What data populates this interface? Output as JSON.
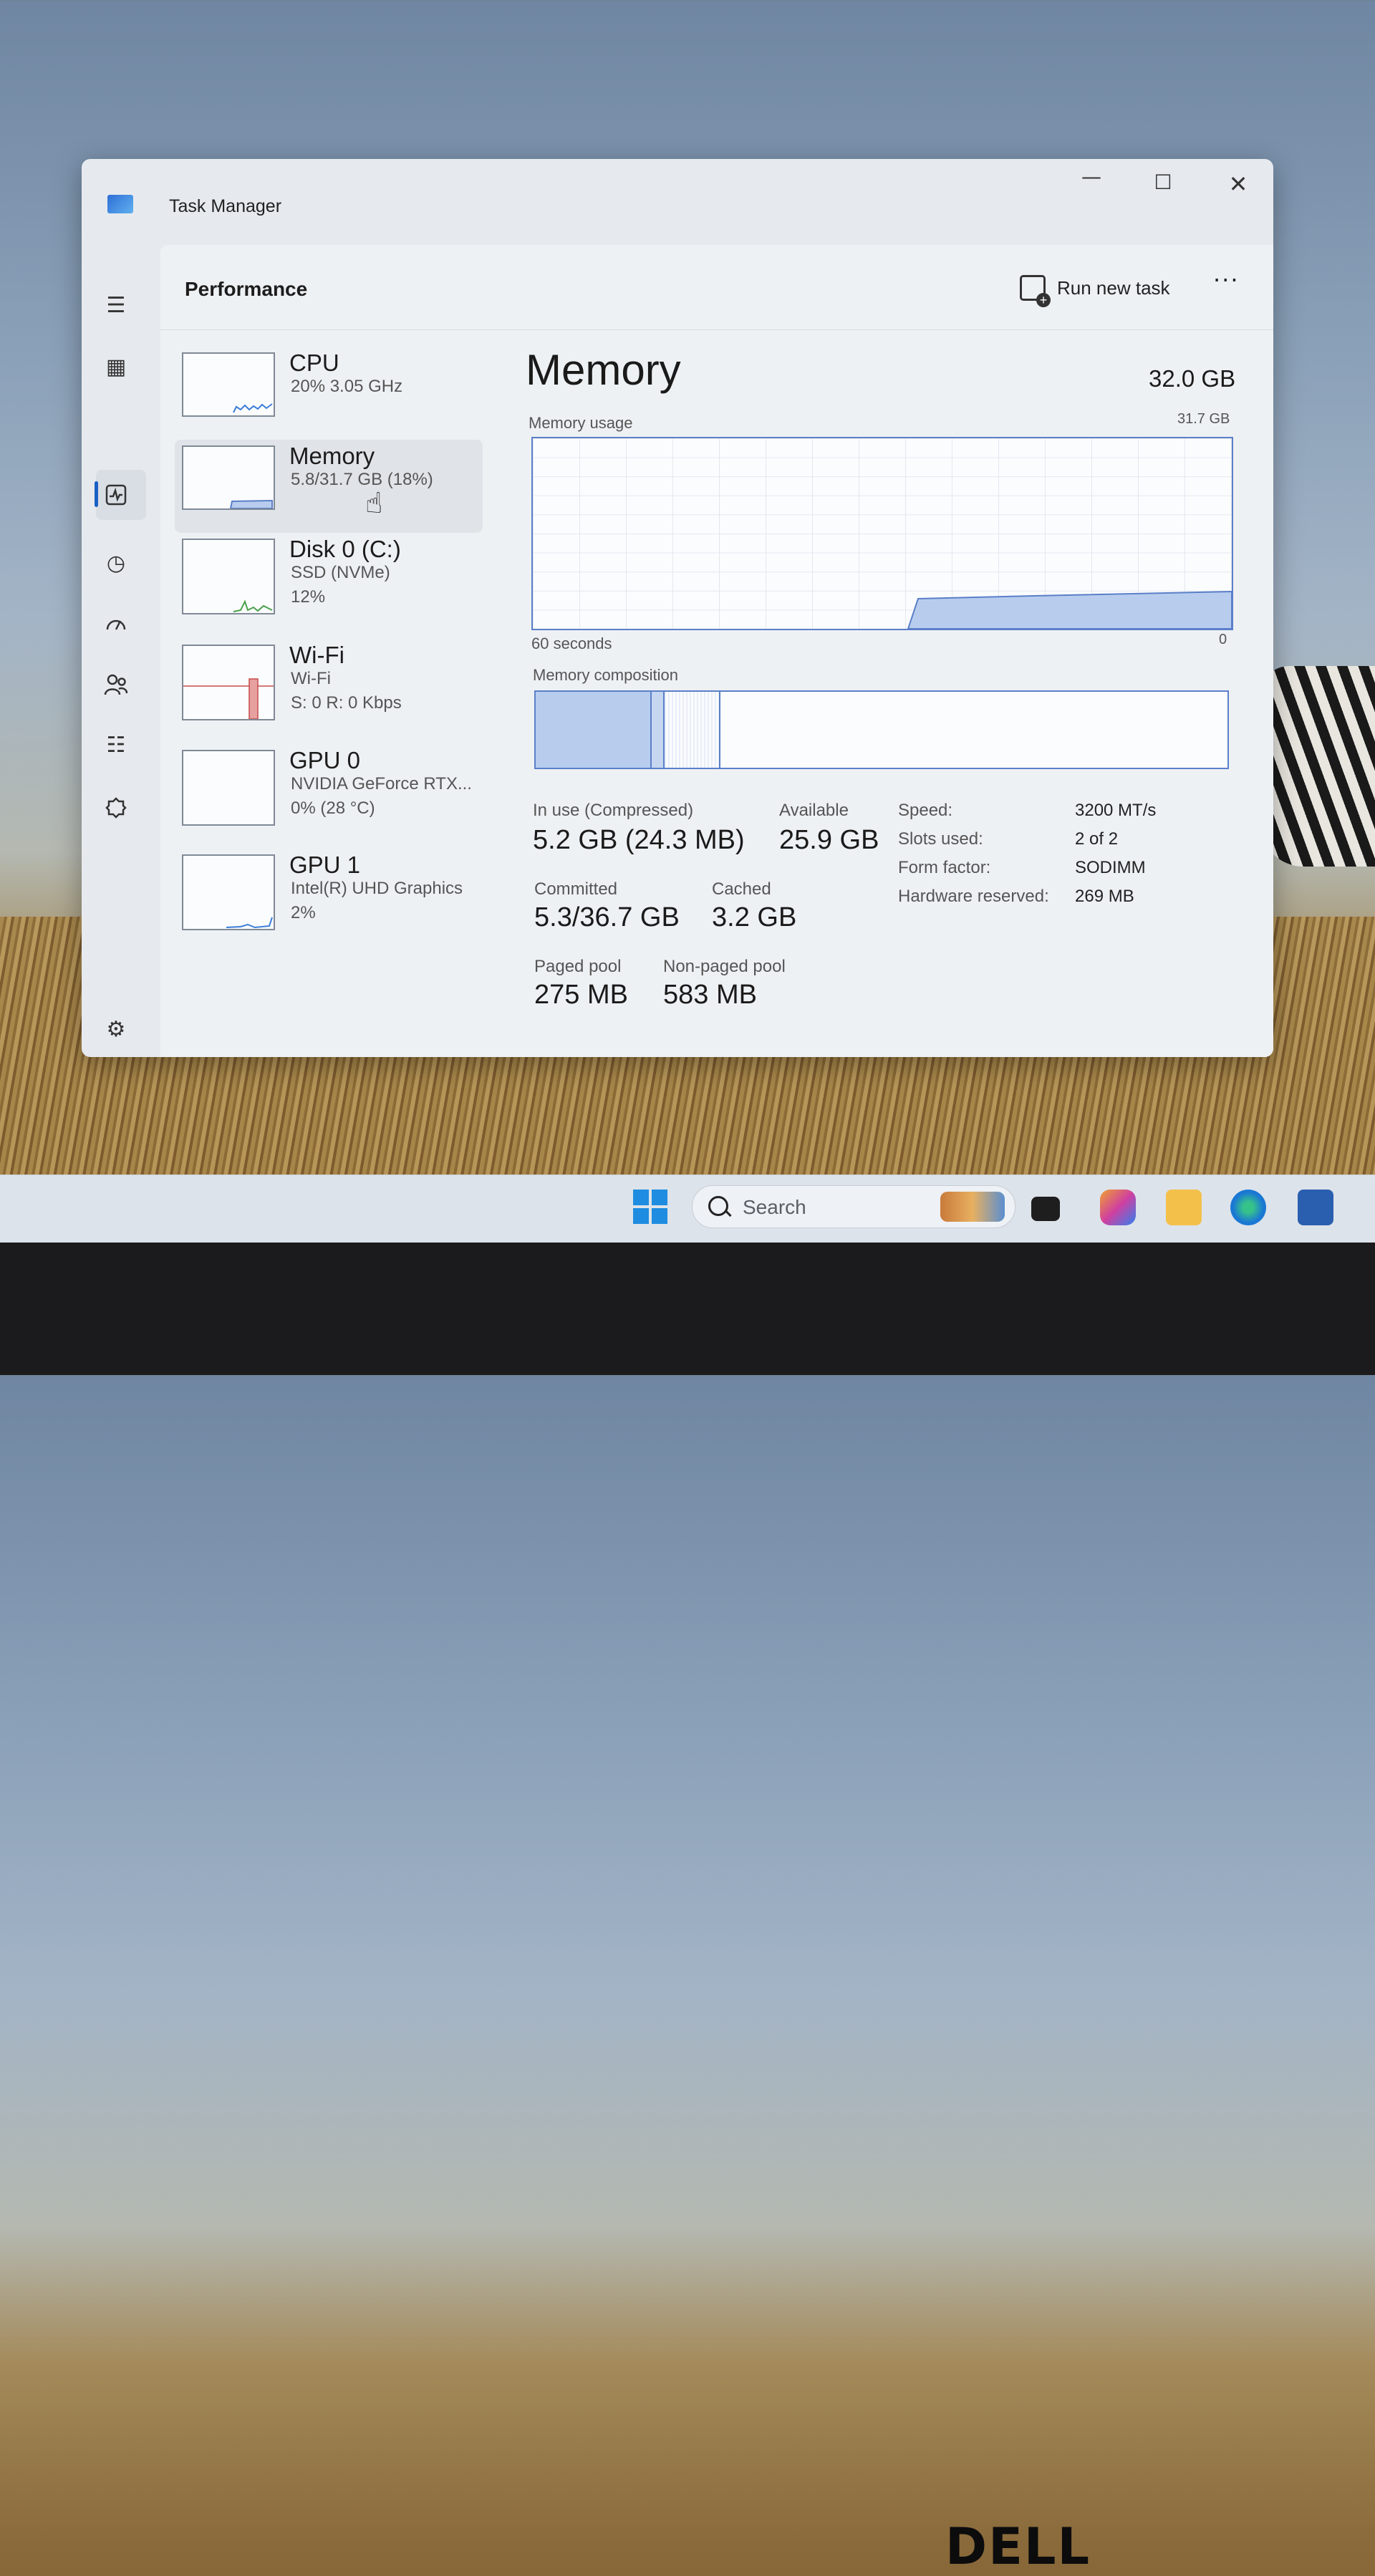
{
  "window": {
    "title": "Task Manager"
  },
  "header": {
    "page_title": "Performance",
    "run_new_task": "Run new task",
    "more": "···"
  },
  "nav_icons": [
    "hamburger-icon",
    "processes-icon",
    "performance-icon",
    "app-history-icon",
    "startup-apps-icon",
    "users-icon",
    "details-icon",
    "services-icon",
    "settings-icon"
  ],
  "devices": [
    {
      "name": "CPU",
      "sub1": "20% 3.05 GHz",
      "sub2": ""
    },
    {
      "name": "Memory",
      "sub1": "5.8/31.7 GB (18%)",
      "sub2": ""
    },
    {
      "name": "Disk 0 (C:)",
      "sub1": "SSD (NVMe)",
      "sub2": "12%"
    },
    {
      "name": "Wi-Fi",
      "sub1": "Wi-Fi",
      "sub2": "S: 0 R: 0 Kbps"
    },
    {
      "name": "GPU 0",
      "sub1": "NVIDIA GeForce RTX...",
      "sub2": "0% (28 °C)"
    },
    {
      "name": "GPU 1",
      "sub1": "Intel(R) UHD Graphics",
      "sub2": "2%"
    }
  ],
  "memory": {
    "title": "Memory",
    "total": "32.0 GB",
    "usage_label": "Memory usage",
    "usage_max": "31.7 GB",
    "time_left": "60 seconds",
    "time_right": "0",
    "composition_label": "Memory composition",
    "in_use_label": "In use (Compressed)",
    "in_use_value": "5.2 GB (24.3 MB)",
    "available_label": "Available",
    "available_value": "25.9 GB",
    "committed_label": "Committed",
    "committed_value": "5.3/36.7 GB",
    "cached_label": "Cached",
    "cached_value": "3.2 GB",
    "paged_label": "Paged pool",
    "paged_value": "275 MB",
    "nonpaged_label": "Non-paged pool",
    "nonpaged_value": "583 MB",
    "specs": [
      {
        "k": "Speed:",
        "v": "3200 MT/s"
      },
      {
        "k": "Slots used:",
        "v": "2 of 2"
      },
      {
        "k": "Form factor:",
        "v": "SODIMM"
      },
      {
        "k": "Hardware reserved:",
        "v": "269 MB"
      }
    ]
  },
  "taskbar": {
    "search_placeholder": "Search"
  },
  "laptop": {
    "brand": "DELL"
  },
  "colors": {
    "accent": "#1a5fc4",
    "graph_fill": "#b8cdee",
    "graph_line": "#5b7fc9"
  }
}
